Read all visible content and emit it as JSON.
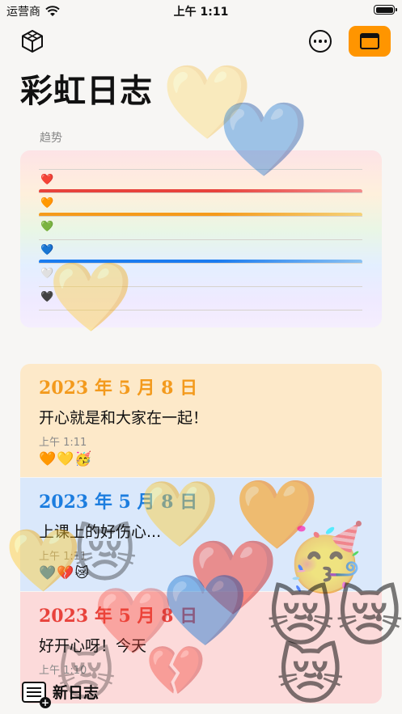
{
  "status_bar": {
    "carrier": "运营商",
    "time": "上午 1:11"
  },
  "nav": {
    "title": "彩虹日志"
  },
  "trend": {
    "label": "趋势",
    "rows": [
      {
        "icon": "❤️",
        "bar_color": "#e8433c",
        "bar_color_end": "#f28b8b",
        "fill": 1.0
      },
      {
        "icon": "🧡",
        "bar_color": "#f59b1b",
        "bar_color_end": "#f5d27a",
        "fill": 1.0
      },
      {
        "icon": "💚",
        "bar_color": "",
        "fill": 0
      },
      {
        "icon": "💙",
        "bar_color": "#1a7cf0",
        "bar_color_end": "#8ac2f3",
        "fill": 1.0
      },
      {
        "icon": "🤍",
        "bar_color": "",
        "fill": 0
      },
      {
        "icon": "🖤",
        "bar_color": "",
        "fill": 0
      }
    ]
  },
  "entries": [
    {
      "date": "2023 年 5 月 8 日",
      "date_color": "#f39a1d",
      "text": "开心就是和大家在一起！",
      "time": "上午 1:11",
      "emojis": "🧡💛🥳"
    },
    {
      "date": "2023 年 5 月 8 日",
      "date_color": "#1c7ddf",
      "text": "上课上的好伤心...",
      "time": "上午 1:11",
      "emojis": "💙💔😿"
    },
    {
      "date": "2023 年 5 月 8 日",
      "date_color": "#e8433c",
      "text": "好开心呀！今天",
      "time": "上午 1:10",
      "emojis": ""
    }
  ],
  "toolbar": {
    "new_entry_label": "新日志"
  }
}
